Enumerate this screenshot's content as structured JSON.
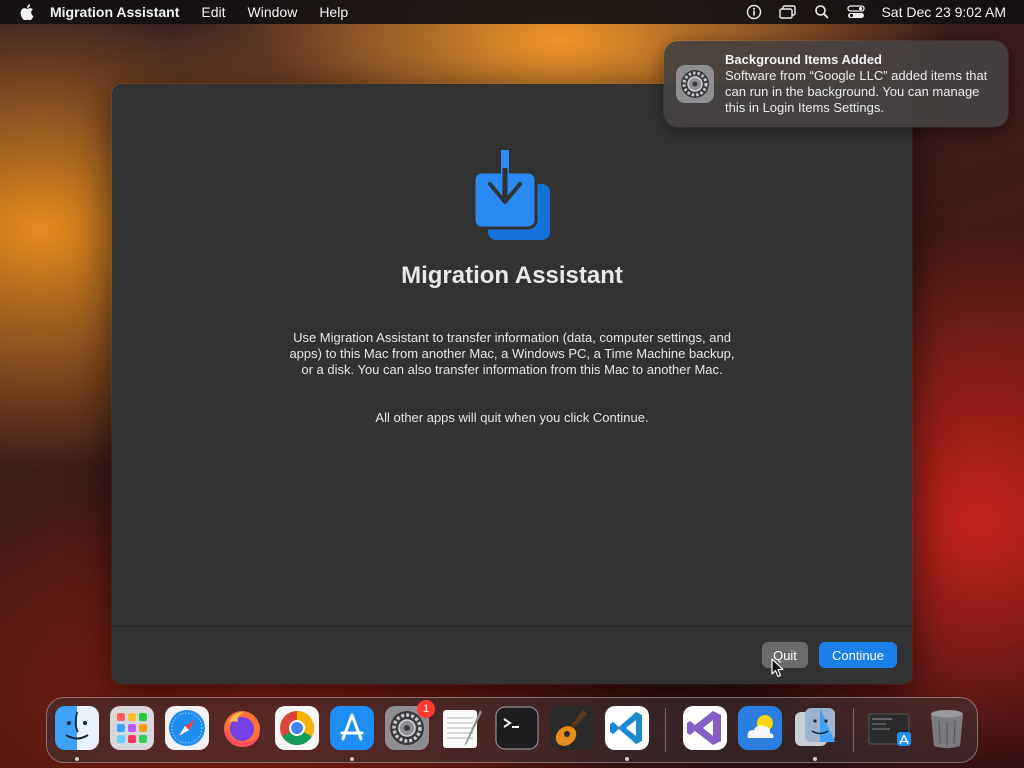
{
  "menubar": {
    "app_name": "Migration Assistant",
    "menus": [
      "Edit",
      "Window",
      "Help"
    ],
    "clock": "Sat Dec 23  9:02 AM",
    "status_icons": [
      "accessibility-icon",
      "screen-mirroring-icon",
      "search-icon",
      "control-center-icon"
    ]
  },
  "window": {
    "title": "Migration Assistant",
    "description": "Use Migration Assistant to transfer information (data, computer settings, and apps) to this Mac from another Mac, a Windows PC, a Time Machine backup, or a disk. You can also transfer information from this Mac to another Mac.",
    "note": "All other apps will quit when you click Continue.",
    "quit_label": "Quit",
    "continue_label": "Continue",
    "accent": "#1a7fe8"
  },
  "notification": {
    "title": "Background Items Added",
    "body": "Software from “Google LLC” added items that can run in the background. You can manage this in Login Items Settings."
  },
  "dock": {
    "items": [
      "finder",
      "launchpad",
      "safari",
      "firefox",
      "chrome",
      "app-store",
      "system-settings",
      "textedit",
      "terminal",
      "garageband",
      "vscode",
      "visual-studio",
      "weather",
      "migration-assistant",
      "screenshot",
      "trash"
    ],
    "system_settings_badge": "1"
  }
}
